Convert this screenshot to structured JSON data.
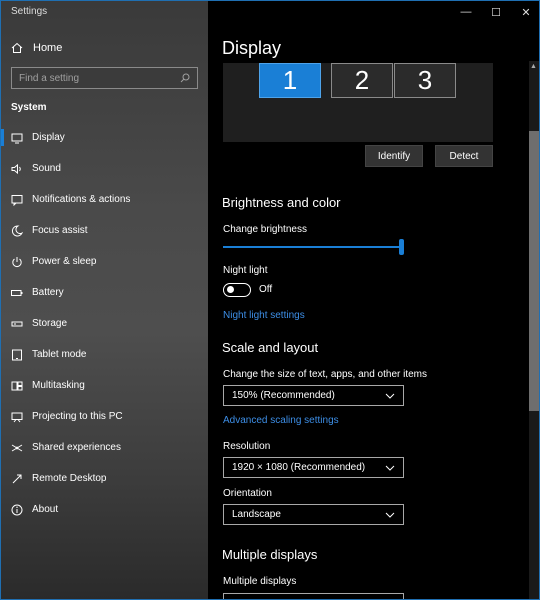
{
  "window": {
    "title": "Settings",
    "controls": {
      "minimize": "—",
      "maximize": "☐",
      "close": "✕"
    }
  },
  "sidebar": {
    "home_label": "Home",
    "search_placeholder": "Find a setting",
    "section": "System",
    "items": [
      {
        "label": "Display",
        "icon": "monitor-icon",
        "active": true
      },
      {
        "label": "Sound",
        "icon": "speaker-icon"
      },
      {
        "label": "Notifications & actions",
        "icon": "notification-icon"
      },
      {
        "label": "Focus assist",
        "icon": "moon-icon"
      },
      {
        "label": "Power & sleep",
        "icon": "power-icon"
      },
      {
        "label": "Battery",
        "icon": "battery-icon"
      },
      {
        "label": "Storage",
        "icon": "storage-icon"
      },
      {
        "label": "Tablet mode",
        "icon": "tablet-icon"
      },
      {
        "label": "Multitasking",
        "icon": "multitasking-icon"
      },
      {
        "label": "Projecting to this PC",
        "icon": "projector-icon"
      },
      {
        "label": "Shared experiences",
        "icon": "shared-icon"
      },
      {
        "label": "Remote Desktop",
        "icon": "remote-icon"
      },
      {
        "label": "About",
        "icon": "info-icon"
      }
    ]
  },
  "main": {
    "title": "Display",
    "monitors": [
      "1",
      "2",
      "3"
    ],
    "identify_label": "Identify",
    "detect_label": "Detect",
    "brightness": {
      "heading": "Brightness and color",
      "change_label": "Change brightness",
      "level_percent": 100,
      "night_light_label": "Night light",
      "night_light_state": "Off",
      "night_light_link": "Night light settings"
    },
    "scale": {
      "heading": "Scale and layout",
      "size_label": "Change the size of text, apps, and other items",
      "size_value": "150% (Recommended)",
      "advanced_link": "Advanced scaling settings",
      "resolution_label": "Resolution",
      "resolution_value": "1920 × 1080 (Recommended)",
      "orientation_label": "Orientation",
      "orientation_value": "Landscape"
    },
    "multiple": {
      "heading": "Multiple displays",
      "label": "Multiple displays"
    }
  },
  "colors": {
    "accent": "#1a7fd6",
    "link": "#3d8ee6"
  }
}
